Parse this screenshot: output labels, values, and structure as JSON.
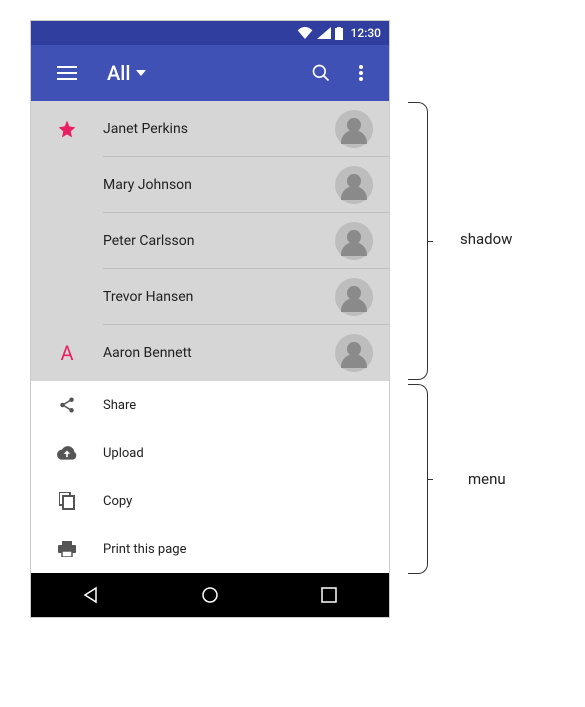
{
  "status": {
    "time": "12:30"
  },
  "appbar": {
    "title": "All"
  },
  "contacts": [
    {
      "leading_type": "star",
      "leading": "",
      "name": "Janet Perkins",
      "div": true
    },
    {
      "leading_type": "none",
      "leading": "",
      "name": "Mary Johnson",
      "div": true
    },
    {
      "leading_type": "none",
      "leading": "",
      "name": "Peter Carlsson",
      "div": true
    },
    {
      "leading_type": "none",
      "leading": "",
      "name": "Trevor Hansen",
      "div": true
    },
    {
      "leading_type": "letter",
      "leading": "A",
      "name": "Aaron Bennett",
      "div": false
    }
  ],
  "menu": [
    {
      "icon": "share",
      "label": "Share"
    },
    {
      "icon": "upload",
      "label": "Upload"
    },
    {
      "icon": "copy",
      "label": "Copy"
    },
    {
      "icon": "print",
      "label": "Print this page"
    }
  ],
  "annotations": {
    "shadow": "shadow",
    "menu": "menu"
  }
}
